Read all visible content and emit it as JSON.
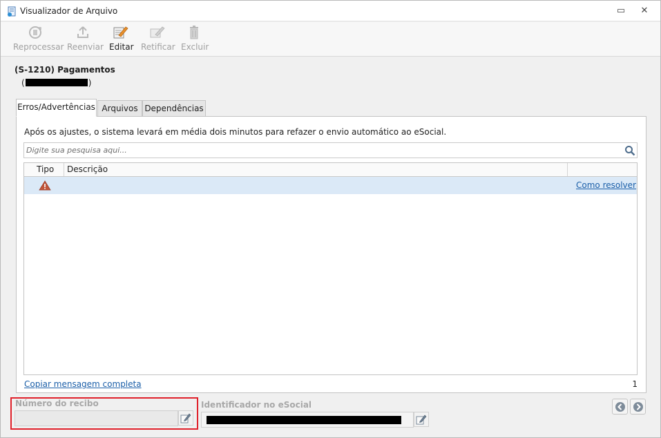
{
  "window": {
    "title": "Visualizador de Arquivo",
    "restore_glyph": "▭",
    "close_glyph": "✕"
  },
  "toolbar": {
    "buttons": [
      {
        "label": "Reprocessar",
        "icon": "reprocess-icon",
        "enabled": false
      },
      {
        "label": "Reenviar",
        "icon": "upload-icon",
        "enabled": false
      },
      {
        "label": "Editar",
        "icon": "edit-icon",
        "enabled": true
      },
      {
        "label": "Retificar",
        "icon": "rectify-icon",
        "enabled": false
      },
      {
        "label": "Excluir",
        "icon": "trash-icon",
        "enabled": false
      }
    ]
  },
  "event": {
    "title": "(S-1210) Pagamentos",
    "subtitle_open": "(",
    "subtitle_close": ")"
  },
  "tabs": [
    {
      "label": "Erros/Advertências",
      "active": true
    },
    {
      "label": "Arquivos",
      "active": false
    },
    {
      "label": "Dependências",
      "active": false
    }
  ],
  "panel": {
    "info": "Após os ajustes, o sistema levará em média dois minutos para refazer o envio automático ao eSocial.",
    "search_placeholder": "Digite sua pesquisa aqui...",
    "columns": {
      "tipo": "Tipo",
      "descricao": "Descrição",
      "extra": ""
    },
    "rows": [
      {
        "tipo_icon": "warning-icon",
        "descricao": "",
        "action": "Como resolver"
      }
    ],
    "copy_link": "Copiar mensagem completa",
    "count": "1"
  },
  "footer": {
    "recibo_label": "Número do recibo",
    "recibo_value": "",
    "identificador_label": "Identificador no eSocial"
  },
  "colors": {
    "accent_link": "#1a5ea8",
    "selected_row": "#dbe9f7",
    "highlight_border": "#e0202a",
    "warning": "#c0392b"
  }
}
